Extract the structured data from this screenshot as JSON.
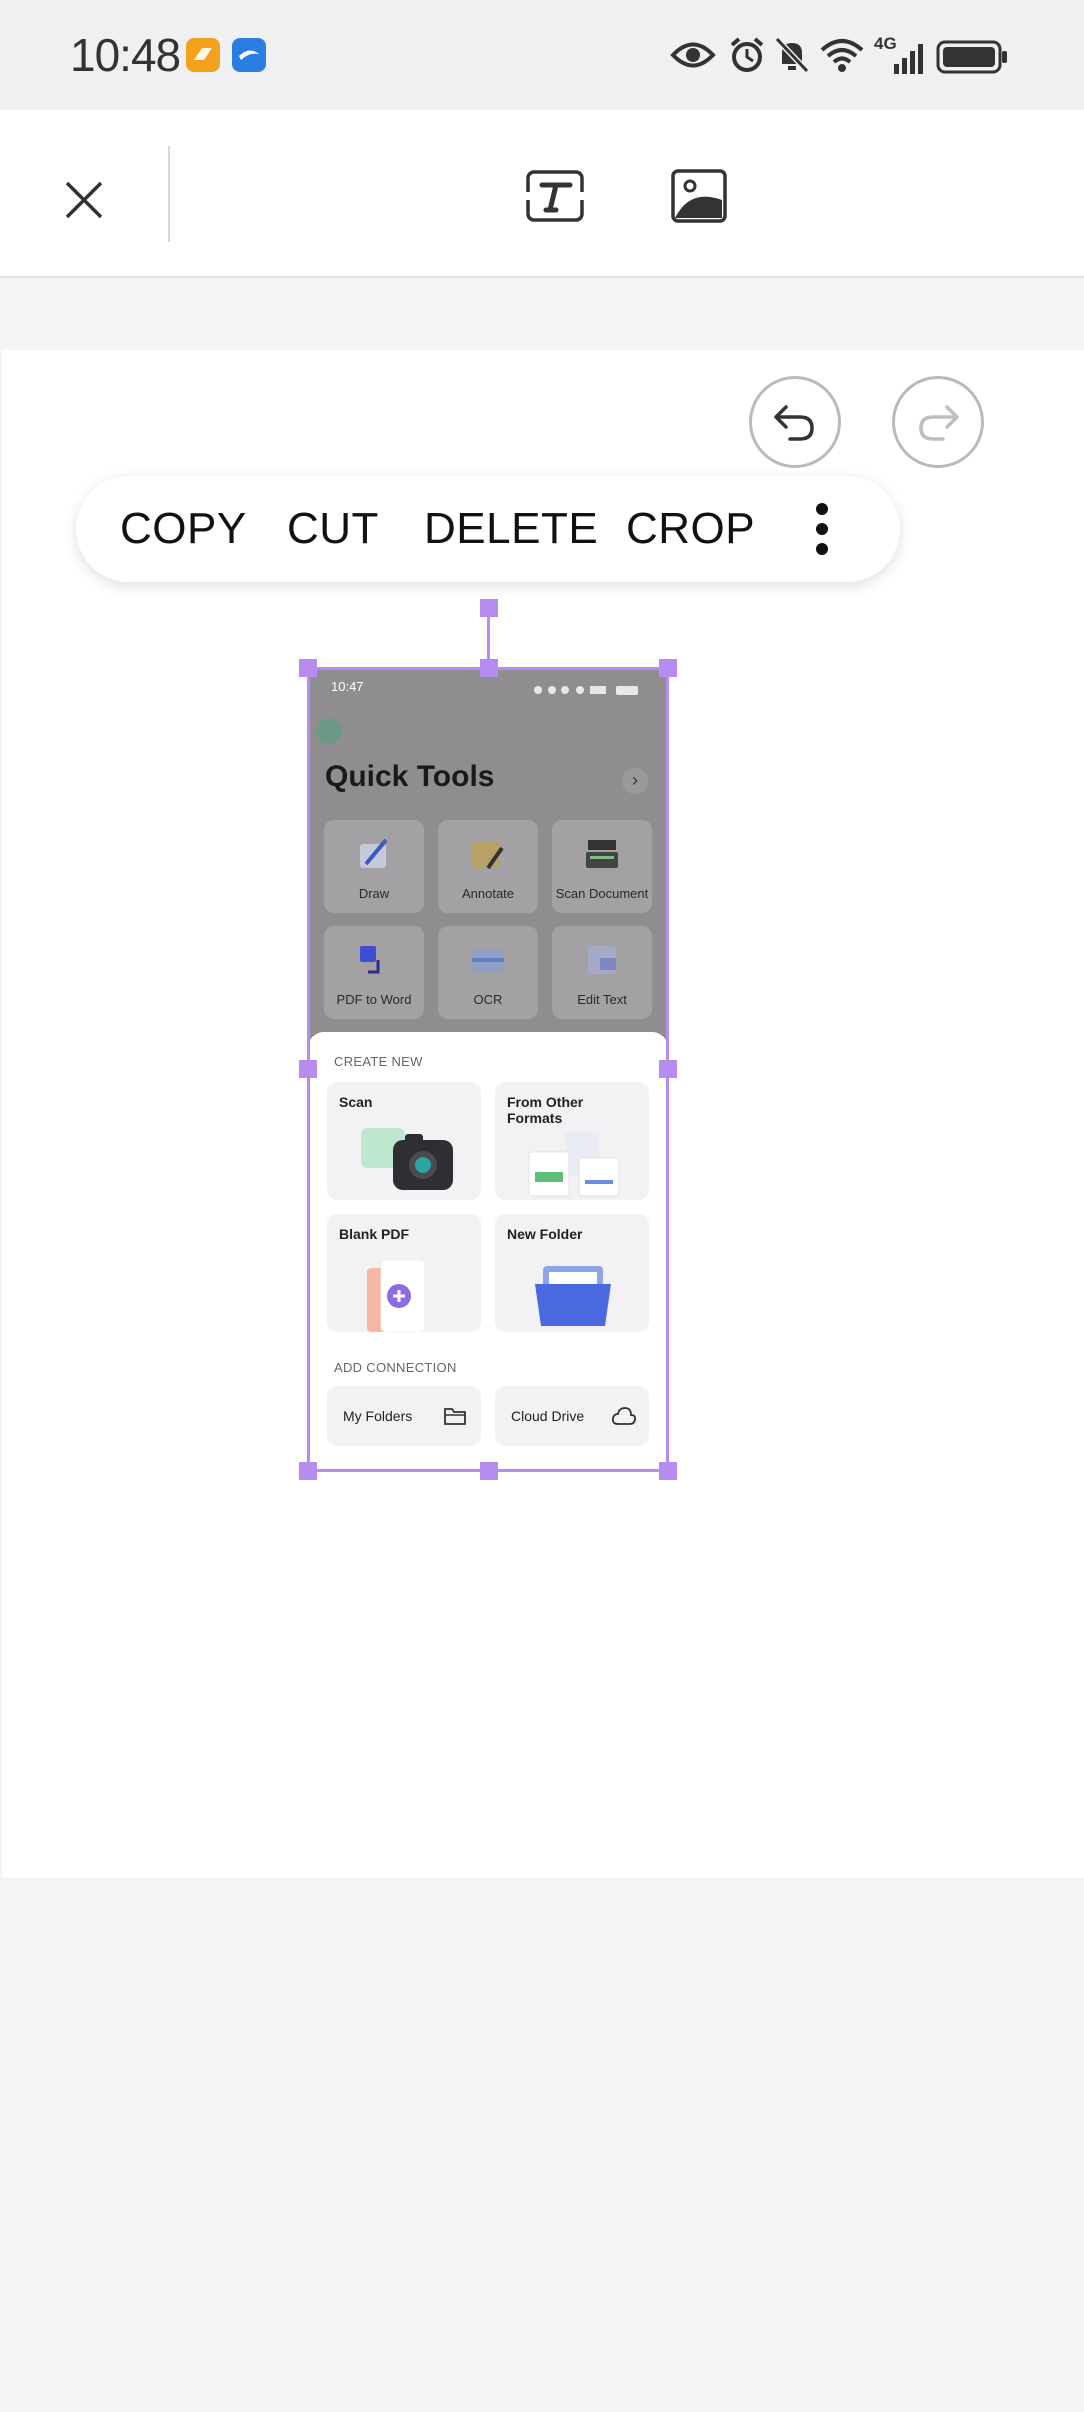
{
  "status_bar": {
    "time": "10:48",
    "network": "4G",
    "icons": [
      "eye-icon",
      "alarm-icon",
      "bell-off-icon",
      "wifi-icon",
      "signal-icon",
      "battery-icon"
    ]
  },
  "toolbar": {
    "close_icon": "close-icon",
    "tools": [
      "text-tool-icon",
      "image-tool-icon"
    ]
  },
  "history": {
    "undo_icon": "undo-icon",
    "redo_icon": "redo-icon"
  },
  "context_menu": {
    "items": [
      "COPY",
      "CUT",
      "DELETE",
      "CROP"
    ],
    "more_icon": "more-vertical-icon"
  },
  "selected_image": {
    "status_time": "10:47",
    "title": "Quick Tools",
    "tools": [
      "Draw",
      "Annotate",
      "Scan Document",
      "PDF to Word",
      "OCR",
      "Edit Text"
    ],
    "create_new_heading": "CREATE NEW",
    "create_items": [
      "Scan",
      "From Other Formats",
      "Blank PDF",
      "New Folder"
    ],
    "add_connection_heading": "ADD CONNECTION",
    "connections": [
      "My Folders",
      "Cloud Drive"
    ]
  },
  "colors": {
    "selection": "#b68cf0",
    "background": "#f4f4f6",
    "page": "#ffffff"
  }
}
